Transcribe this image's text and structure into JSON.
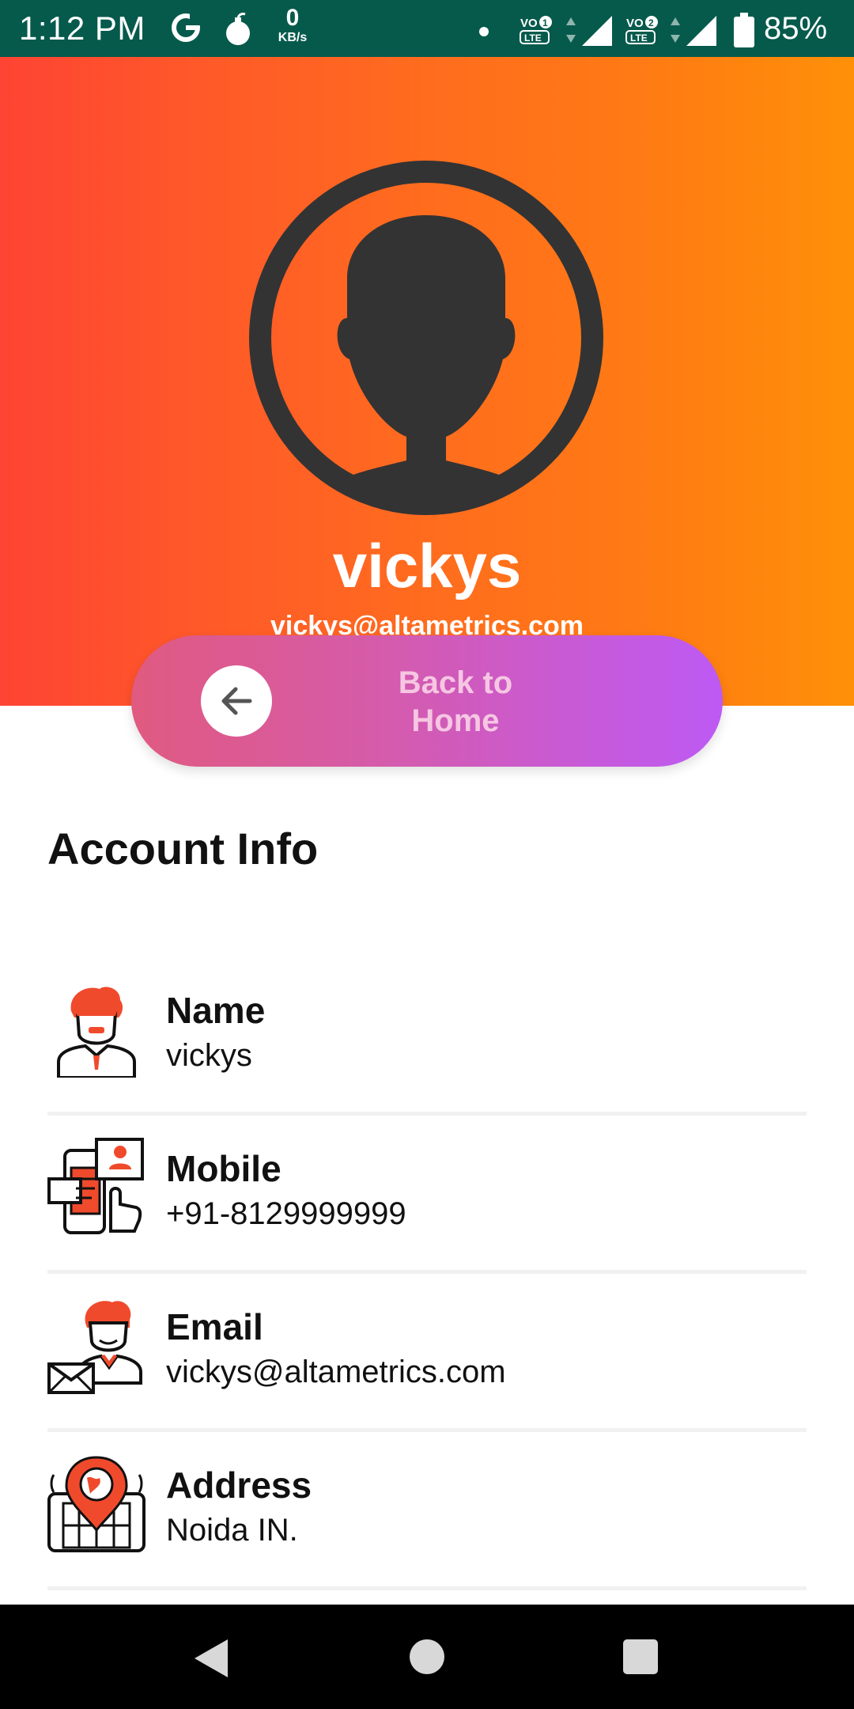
{
  "status_bar": {
    "time": "1:12 PM",
    "net_speed_value": "0",
    "net_speed_unit": "KB/s",
    "volte1": "VO 1 LTE",
    "volte2": "VO 2 LTE",
    "battery": "85%",
    "icons": [
      "g-icon",
      "bomb-icon",
      "dot-icon",
      "volte-icon",
      "signal-icon",
      "battery-icon"
    ]
  },
  "header": {
    "username": "vickys",
    "email": "vickys@altametrics.com",
    "gradient_start": "#fe4433",
    "gradient_end": "#ff9008"
  },
  "back_button": {
    "label_line1": "Back to",
    "label_line2": "Home",
    "icon": "arrow-left-icon"
  },
  "account": {
    "title": "Account Info",
    "rows": [
      {
        "label": "Name",
        "value": "vickys",
        "icon": "person-icon"
      },
      {
        "label": "Mobile",
        "value": "+91-8129999999",
        "icon": "mobile-icon"
      },
      {
        "label": "Email",
        "value": "vickys@altametrics.com",
        "icon": "email-icon"
      },
      {
        "label": "Address",
        "value": "Noida IN.",
        "icon": "location-icon"
      }
    ]
  },
  "nav_bar": {
    "buttons": [
      "back-icon",
      "home-icon",
      "recents-icon"
    ]
  },
  "colors": {
    "status_bar": "#065a4c",
    "button_start": "#e05a80",
    "button_end": "#bd5af4",
    "icon_accent": "#f04a2c"
  }
}
